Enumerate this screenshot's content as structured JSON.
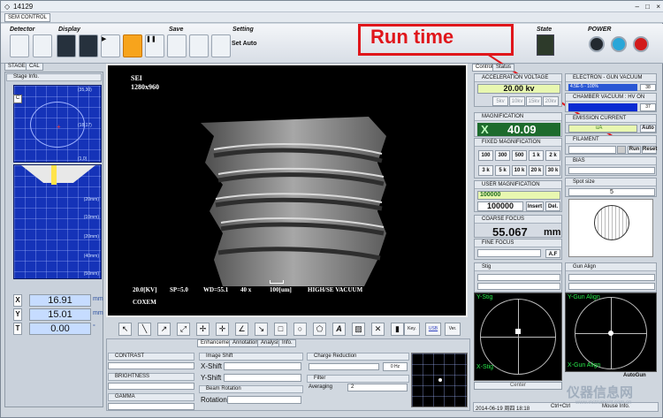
{
  "window": {
    "title": "14129",
    "menu": "SEM CONTROL"
  },
  "toolbar": {
    "groups": [
      "Detector",
      "Display",
      "Save",
      "Setting",
      "State",
      "POWER"
    ],
    "set_auto": "Set Auto"
  },
  "annotation": {
    "text": "Run time"
  },
  "left": {
    "tabs": [
      "STAGE",
      "CAL"
    ],
    "stage_info": "Stage Info.",
    "top_nums": [
      "(35,30)",
      "(18,17)",
      "(1,0)"
    ],
    "side_nums": [
      "(20mm)",
      "(10mm)",
      "(20mm)",
      "(40mm)",
      "(50mm)"
    ],
    "c_label": "C",
    "coords": [
      {
        "axis": "X",
        "value": "16.91",
        "unit": "mm"
      },
      {
        "axis": "Y",
        "value": "15.01",
        "unit": "mm"
      },
      {
        "axis": "T",
        "value": "0.00",
        "unit": "°"
      }
    ]
  },
  "image": {
    "mode": "SEI",
    "resolution": "1280x960",
    "kv": "20.0[KV]",
    "sp": "SP=5.0",
    "wd": "WD=55.1",
    "mag": "40 x",
    "scale": "100[um]",
    "vacuum": "HIGH/SE VACUUM",
    "brand": "COXEM"
  },
  "tools": {
    "key": "Key.",
    "usb": "USB",
    "ver": "Ver."
  },
  "bottom": {
    "tabs": [
      "Enhancement",
      "Annotation",
      "Analysis",
      "Info."
    ],
    "contrast": "CONTRAST",
    "brightness": "BRIGHTNESS",
    "gamma": "GAMMA",
    "image_shift": "Image Shift",
    "x_shift": "X-Shift",
    "y_shift": "Y-Shift",
    "beam_rotation": "Beam Rotation",
    "rotation": "Rotation",
    "charge_reduction": "Charge Reduction",
    "charge_value": "0 Hz",
    "filter": "Filter",
    "averaging": "Averaging",
    "averaging_value": "2"
  },
  "control": {
    "tabs": [
      "Control",
      "Status"
    ],
    "accel_title": "ACCELERATION VOLTAGE",
    "accel_value": "20.00 kv",
    "kv_buttons": [
      "5kv",
      "10kv",
      "15kv",
      "20kv"
    ],
    "mag_title": "MAGNIFICATION",
    "mag_x": "X",
    "mag_value": "40.09",
    "fixed_title": "FIXED MAGNIFICATION",
    "fixed_row1": [
      "100",
      "300",
      "500",
      "1 k",
      "2 k"
    ],
    "fixed_row2": [
      "3 k",
      "5 k",
      "10 k",
      "20 k",
      "30 k"
    ],
    "user_title": "USER MAGNIFICATION",
    "user_value": "100000",
    "user_input": "100000",
    "insert": "Insert",
    "del": "Del.",
    "coarse_title": "COARSE FOCUS",
    "coarse_value": "55.067",
    "coarse_unit": "mm",
    "fine_title": "FINE FOCUS",
    "af": "A.F",
    "stig_title": "Stig",
    "ystig": "Y-Stig",
    "xstig": "X-Stig",
    "center": "Center"
  },
  "gun": {
    "vac_title": "ELECTRON - GUN VACUUM",
    "vac_value": "4.5E-5 - 100%",
    "vac_num": "38",
    "chamber_title": "CHAMBER VACUUM : HV ON",
    "chamber_num": "37",
    "emission_title": "EMISSION CURRENT",
    "emission_value": "uA",
    "auto": "Auto",
    "filament_title": "FILAMENT",
    "run": "Run",
    "reset": "Reset",
    "bias_title": "BIAS",
    "spot_title": "Spot size",
    "spot_value": "5",
    "gun_align_title": "Gun Align",
    "ygun": "Y-Gun Align",
    "xgun": "X-Gun Align",
    "autogun": "AutoGun"
  },
  "status": {
    "datetime": "2014-06-19 周四 18:18",
    "keys": "Ctrl+Ctrl",
    "mouse": "Mouse Info."
  },
  "watermark": "仪器信息网",
  "watermark_url": "www.instrument.com.cn",
  "colors": {
    "accent": "#1533b8",
    "annotation": "#e0161b",
    "brand_green": "#28e84b"
  }
}
